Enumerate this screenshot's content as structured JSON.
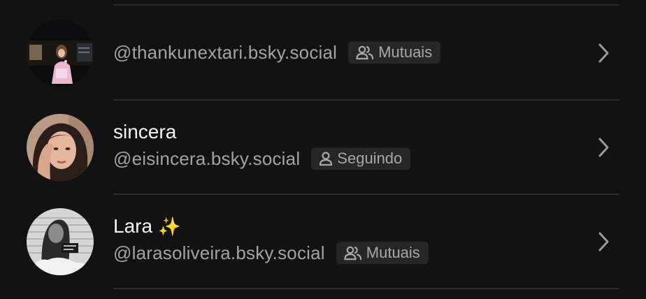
{
  "rows": [
    {
      "display_name": "",
      "handle": "@thankunextari.bsky.social",
      "badge": {
        "label": "Mutuais",
        "icon": "users-icon"
      }
    },
    {
      "display_name": "sincera",
      "handle": "@eisincera.bsky.social",
      "badge": {
        "label": "Seguindo",
        "icon": "user-icon"
      }
    },
    {
      "display_name": "Lara",
      "display_emoji": "✨",
      "handle": "@larasoliveira.bsky.social",
      "badge": {
        "label": "Mutuais",
        "icon": "users-icon"
      }
    }
  ],
  "colors": {
    "background": "#121212",
    "divider": "#2b2b2b",
    "handle_text": "#a3a3a3",
    "badge_bg": "#262626"
  }
}
